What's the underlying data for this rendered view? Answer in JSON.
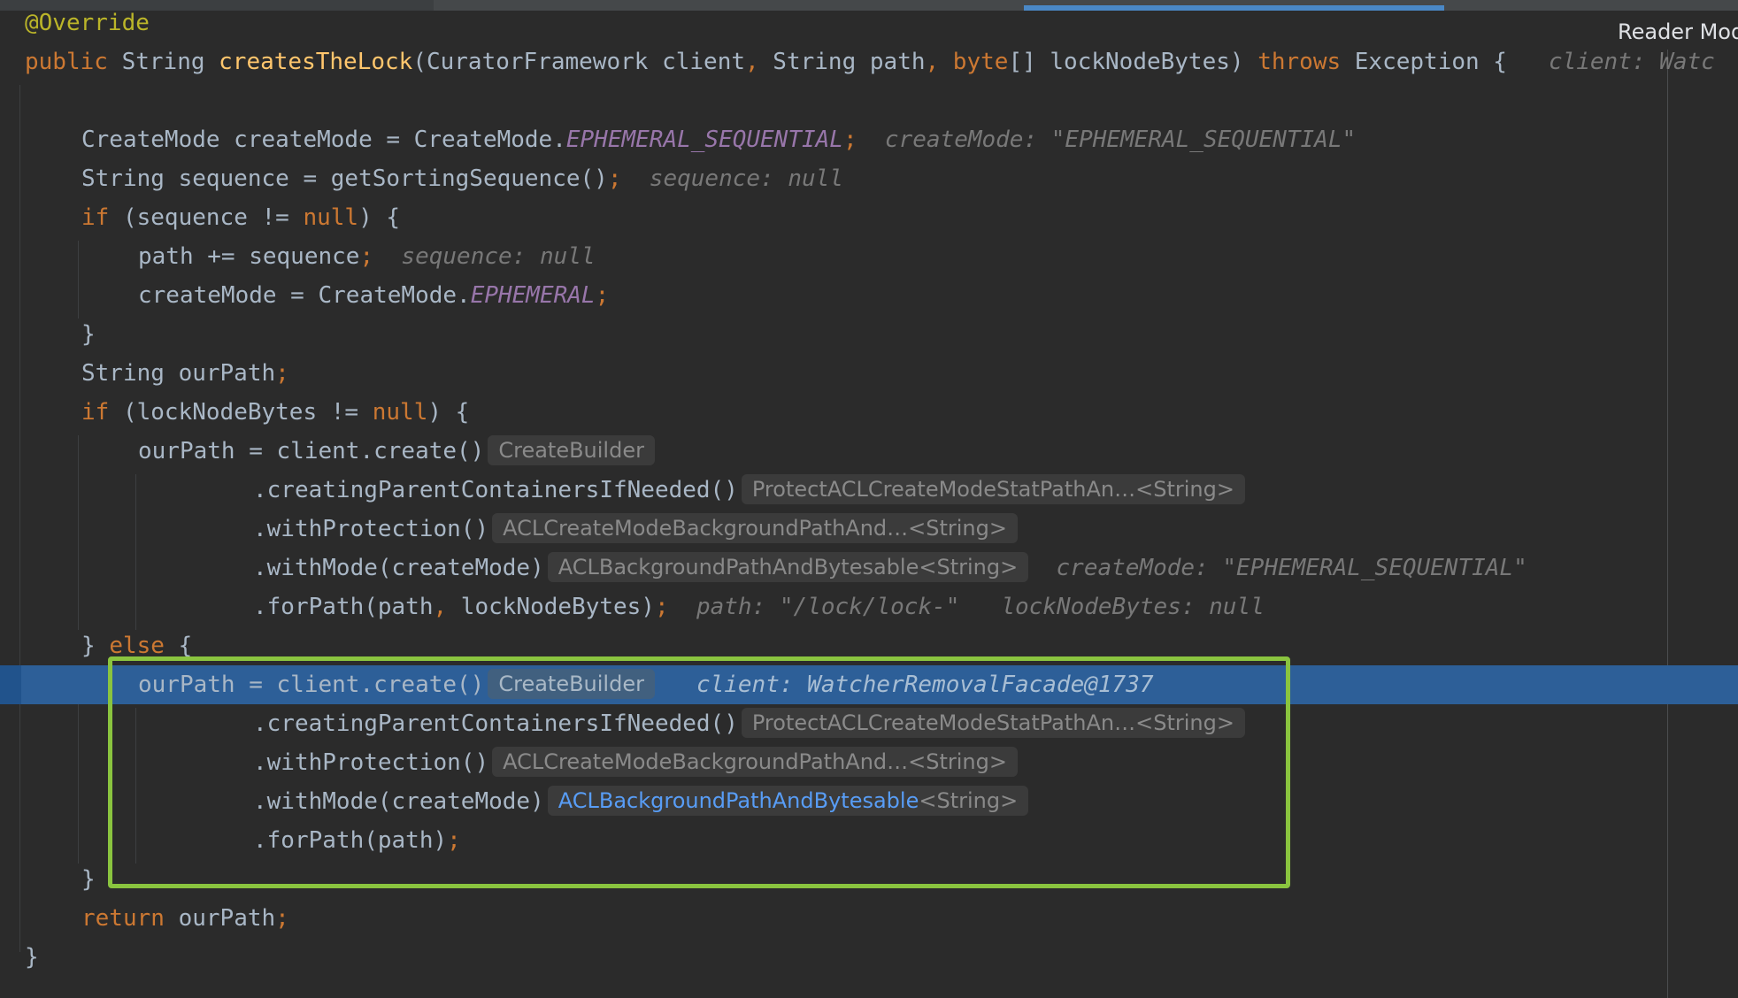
{
  "editor": {
    "reader_mode_label": "Reader Mod",
    "code": {
      "l1": {
        "text": "@Override"
      },
      "l2": {
        "public": "public",
        "string": "String",
        "method": "createsTheLock",
        "open_paren": "(",
        "param1_type": "CuratorFramework",
        "param1_name": " client",
        "comma1": ",",
        "param2": " String path",
        "comma2": ",",
        "byte_kw": " byte",
        "param3": "[] lockNodeBytes)",
        "throws": " throws",
        "rest": " Exception {",
        "hint": "client: Watc"
      },
      "l4": {
        "lhs": "CreateMode createMode = CreateMode.",
        "const": "EPHEMERAL_SEQUENTIAL",
        "semi": ";",
        "hint": "createMode: \"EPHEMERAL_SEQUENTIAL\""
      },
      "l5": {
        "text": "String sequence = getSortingSequence()",
        "semi": ";",
        "hint": "sequence: null"
      },
      "l6": {
        "kw": "if",
        "mid": " (sequence != ",
        "null": "null",
        "end": ") {"
      },
      "l7": {
        "text": "path += sequence",
        "semi": ";",
        "hint": "sequence: null"
      },
      "l8": {
        "lhs": "createMode = CreateMode.",
        "const": "EPHEMERAL",
        "semi": ";"
      },
      "l9": {
        "text": "}"
      },
      "l10": {
        "text": "String ourPath",
        "semi": ";"
      },
      "l11": {
        "kw": "if",
        "mid": " (lockNodeBytes != ",
        "null": "null",
        "end": ") {"
      },
      "l12": {
        "text": "ourPath = client.create()",
        "inlay": "CreateBuilder"
      },
      "l13": {
        "text": ".creatingParentContainersIfNeeded()",
        "inlay": "ProtectACLCreateModeStatPathAn…<String>"
      },
      "l14": {
        "text": ".withProtection()",
        "inlay": "ACLCreateModeBackgroundPathAnd…<String>"
      },
      "l15": {
        "text": ".withMode(createMode)",
        "inlay": "ACLBackgroundPathAndBytesable<String>",
        "hint": "createMode: \"EPHEMERAL_SEQUENTIAL\""
      },
      "l16": {
        "a": ".forPath(path",
        "comma": ",",
        "b": " lockNodeBytes)",
        "semi": ";",
        "hint1": "path: \"/lock/lock-\"",
        "hint2": "lockNodeBytes: null"
      },
      "l17": {
        "brace": "} ",
        "kw": "else",
        "end": " {"
      },
      "l18": {
        "text": "ourPath = client.create()",
        "inlay": "CreateBuilder",
        "hint": "client: WatcherRemovalFacade@1737"
      },
      "l19": {
        "text": ".creatingParentContainersIfNeeded()",
        "inlay": "ProtectACLCreateModeStatPathAn…<String>"
      },
      "l20": {
        "text": ".withProtection()",
        "inlay": "ACLCreateModeBackgroundPathAnd…<String>"
      },
      "l21": {
        "text": ".withMode(createMode)",
        "inlay_link": "ACLBackgroundPathAndBytesable",
        "inlay_rest": "<String>"
      },
      "l22": {
        "text": ".forPath(path)",
        "semi": ";"
      },
      "l23": {
        "text": "}"
      },
      "l24": {
        "kw": "return",
        "text": " ourPath",
        "semi": ";"
      },
      "l25": {
        "text": "}"
      }
    }
  },
  "colors": {
    "background": "#2b2b2b",
    "keyword": "#cc7832",
    "annotation": "#bbb529",
    "method": "#ffc66d",
    "constant": "#9876aa",
    "text": "#a9b7c6",
    "execution_highlight": "#2d5f98",
    "frame": "#8ac43f",
    "link": "#589df6"
  }
}
